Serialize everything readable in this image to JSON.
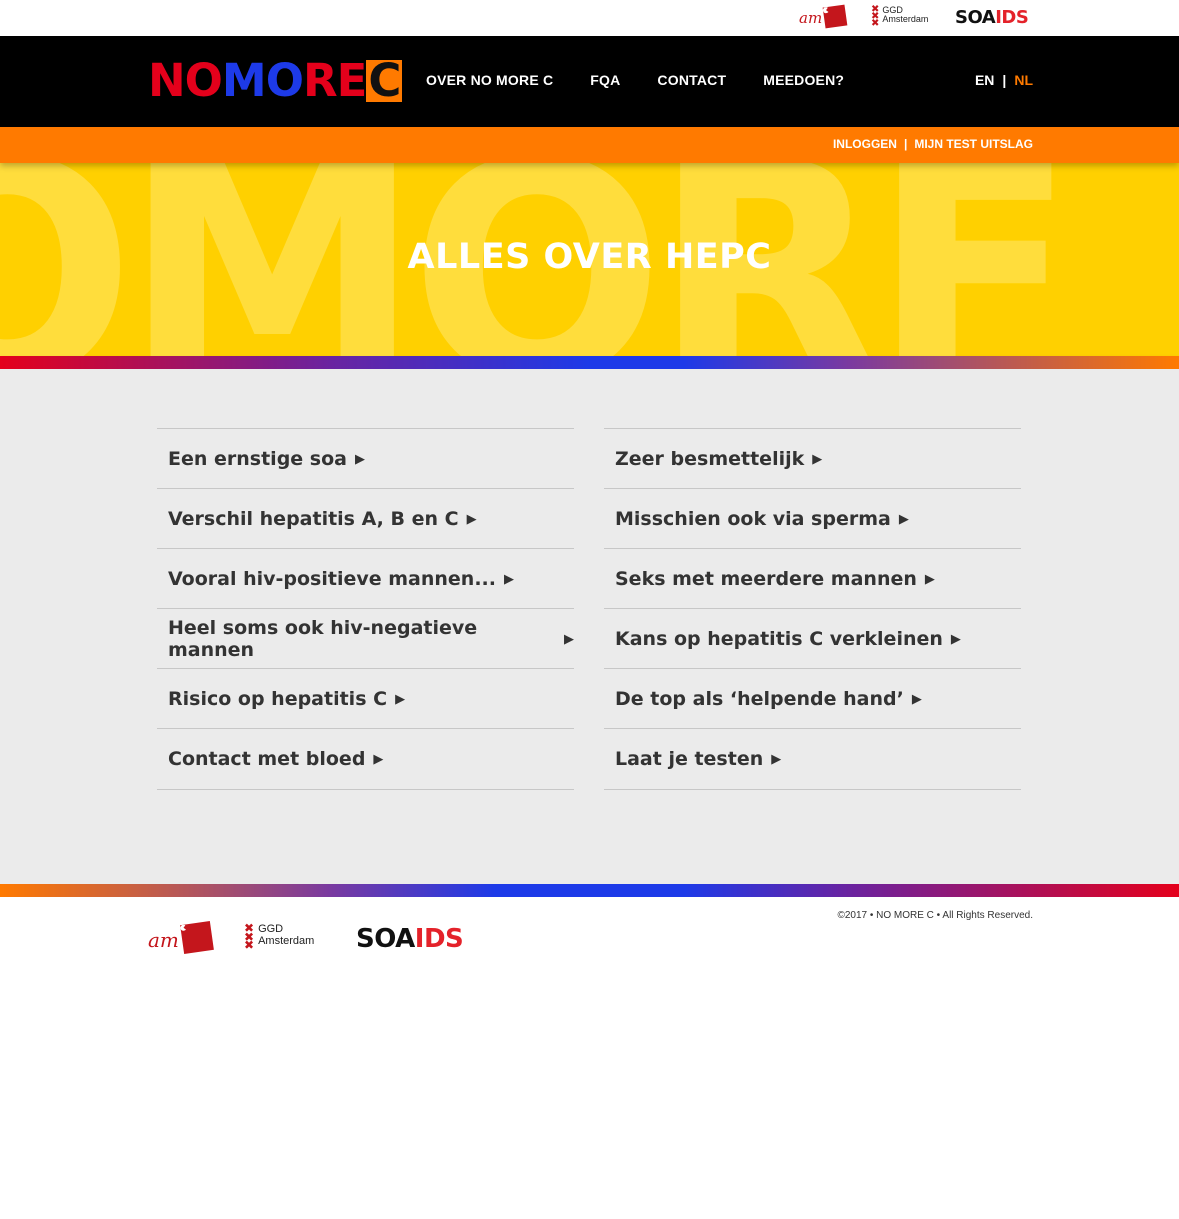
{
  "partners": {
    "amc": {
      "am": "am"
    },
    "ggd": {
      "line1": "GGD",
      "line2": "Amsterdam"
    },
    "soaids": {
      "part1": "SOA",
      "part2": "IDS"
    }
  },
  "header": {
    "logo": {
      "no": "NO",
      "mo": "MO",
      "re": "RE",
      "c": "C"
    },
    "nav": [
      "OVER NO MORE C",
      "FQA",
      "CONTACT",
      "MEEDOEN?"
    ],
    "lang": {
      "en": "EN",
      "separator": "|",
      "nl": "NL",
      "active": "NL"
    }
  },
  "loginbar": {
    "login": "INLOGGEN",
    "separator": "|",
    "result": "MIJN TEST UITSLAG"
  },
  "hero": {
    "title": "ALLES OVER HEPC",
    "bg_letters": "OMORF"
  },
  "topics": {
    "left": [
      "Een ernstige soa",
      "Verschil hepatitis A, B en C",
      "Vooral hiv-positieve mannen...",
      "Heel soms ook hiv-negatieve mannen",
      "Risico op hepatitis C",
      "Contact met bloed"
    ],
    "right": [
      "Zeer besmettelijk",
      "Misschien ook via sperma",
      "Seks met meerdere mannen",
      "Kans op hepatitis C verkleinen",
      "De top als ‘helpende hand’",
      "Laat je testen"
    ],
    "arrow": "▶"
  },
  "footer": {
    "copyright": "©2017 • NO MORE C  • All Rights Reserved."
  },
  "colors": {
    "orange": "#ff7a00",
    "yellow": "#ffd000",
    "red": "#e4001b",
    "blue": "#1d3ae8",
    "black": "#000000"
  }
}
